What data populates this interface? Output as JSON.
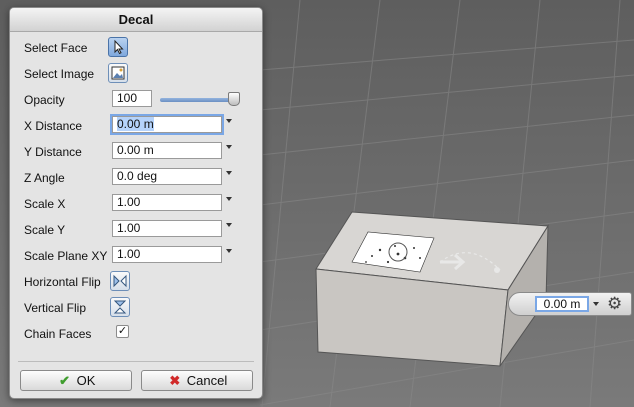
{
  "dialog": {
    "title": "Decal",
    "rows": {
      "select_face": "Select Face",
      "select_image": "Select Image",
      "opacity": {
        "label": "Opacity",
        "value": "100",
        "level_fraction": 1.0
      },
      "x_distance": {
        "label": "X Distance",
        "value": "0.00 m"
      },
      "y_distance": {
        "label": "Y Distance",
        "value": "0.00 m"
      },
      "z_angle": {
        "label": "Z Angle",
        "value": "0.0 deg"
      },
      "scale_x": {
        "label": "Scale X",
        "value": "1.00"
      },
      "scale_y": {
        "label": "Scale Y",
        "value": "1.00"
      },
      "scale_plane_xy": {
        "label": "Scale Plane XY",
        "value": "1.00"
      },
      "horizontal_flip": "Horizontal Flip",
      "vertical_flip": "Vertical Flip",
      "chain_faces": {
        "label": "Chain Faces",
        "checked": true,
        "check_glyph": "✓"
      }
    },
    "buttons": {
      "ok": {
        "label": "OK",
        "icon": "check-icon",
        "color": "#3f9d2e"
      },
      "cancel": {
        "label": "Cancel",
        "icon": "cross-icon",
        "color": "#d12a2a"
      }
    }
  },
  "viewport": {
    "floating_value": "0.00 m",
    "icons": [
      "gear-icon",
      "chevron-down-icon"
    ]
  },
  "colors": {
    "accent": "#7aa7e6",
    "background": "#6b6b6b",
    "box_top": "#d6d4d2",
    "box_front": "#c8c5c2"
  }
}
